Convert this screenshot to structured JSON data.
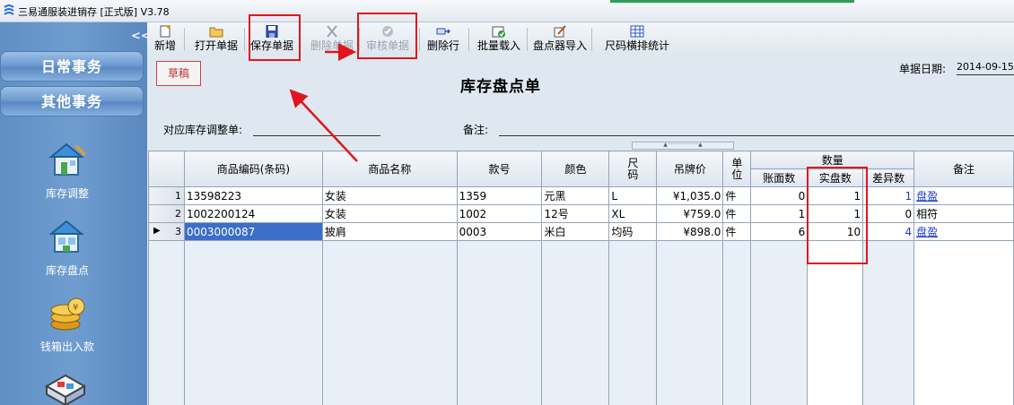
{
  "window": {
    "title": "三易通服装进销存 [正式版] V3.78"
  },
  "sidebar": {
    "collapse_glyph": "<<",
    "groups": [
      {
        "label": "日常事务"
      },
      {
        "label": "其他事务"
      }
    ],
    "items": [
      {
        "label": "库存调整",
        "icon": "inventory-adjust-icon"
      },
      {
        "label": "库存盘点",
        "icon": "inventory-count-icon"
      },
      {
        "label": "钱箱出入款",
        "icon": "cashbox-icon"
      }
    ]
  },
  "toolbar": {
    "new": "新增",
    "open": "打开单据",
    "save": "保存单据",
    "delete_doc": "删除单据",
    "audit": "审核单据",
    "delete_row": "删除行",
    "batch_import": "批量载入",
    "scanner_import": "盘点器导入",
    "size_stats": "尺码横排统计"
  },
  "form": {
    "status_badge": "草稿",
    "title": "库存盘点单",
    "date_label": "单据日期:",
    "date_value": "2014-09-15",
    "adjust_label": "对应库存调整单:",
    "note_label": "备注:",
    "splitter_text": "▲··················▲"
  },
  "table": {
    "headers": {
      "code": "商品编码(条码)",
      "name": "商品名称",
      "style": "款号",
      "color": "颜色",
      "size": "尺码",
      "price": "吊牌价",
      "unit": "单位",
      "qty_group": "数量",
      "book": "账面数",
      "actual": "实盘数",
      "diff": "差异数",
      "note": "备注"
    },
    "rows": [
      {
        "idx": "1",
        "code": "13598223",
        "name": "女装",
        "style": "1359",
        "color": "元黑",
        "size": "L",
        "price": "¥1,035.0",
        "unit": "件",
        "book": "0",
        "actual": "1",
        "diff": "1",
        "note": "盘盈"
      },
      {
        "idx": "2",
        "code": "1002200124",
        "name": "女装",
        "style": "1002",
        "color": "12号",
        "size": "XL",
        "price": "¥759.0",
        "unit": "件",
        "book": "1",
        "actual": "1",
        "diff": "0",
        "note": "相符"
      },
      {
        "idx": "3",
        "code": "0003000087",
        "name": "披肩",
        "style": "0003",
        "color": "米白",
        "size": "均码",
        "price": "¥898.0",
        "unit": "件",
        "book": "6",
        "actual": "10",
        "diff": "4",
        "note": "盘盈"
      }
    ]
  },
  "colors": {
    "highlight": "#e0161c",
    "selection": "#3a6ec9",
    "link": "#1f3bd6"
  }
}
